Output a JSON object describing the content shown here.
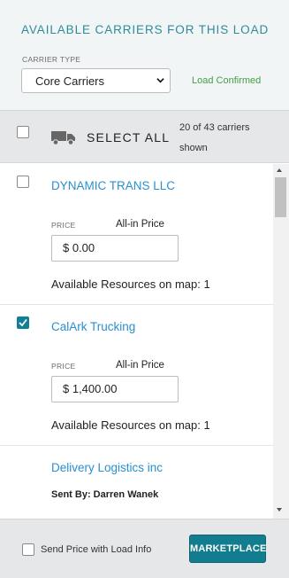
{
  "header": {
    "title": "AVAILABLE CARRIERS FOR THIS LOAD",
    "carrier_type_label": "CARRIER TYPE",
    "carrier_type_selected": "Core Carriers",
    "status": "Load Confirmed"
  },
  "select_bar": {
    "select_all_label": "SELECT ALL",
    "shown_text": "20 of 43 carriers shown",
    "select_all_checked": false
  },
  "carriers": [
    {
      "name": "DYNAMIC TRANS LLC",
      "checked": false,
      "price_label": "PRICE",
      "price_type": "All-in Price",
      "price_value": "$ 0.00",
      "resources_text": "Available Resources on map:  1"
    },
    {
      "name": "CalArk Trucking",
      "checked": true,
      "price_label": "PRICE",
      "price_type": "All-in Price",
      "price_value": "$ 1,400.00",
      "resources_text": "Available Resources on map:  1"
    },
    {
      "name": "Delivery Logistics inc",
      "sent_by": "Sent By: Darren Wanek"
    }
  ],
  "footer": {
    "send_price_label": "Send Price with Load Info",
    "send_price_checked": false,
    "marketplace_label": "MARKETPLACE"
  },
  "colors": {
    "accent": "#127d8e",
    "link": "#2a8fcf",
    "status_green": "#43a047",
    "header_bg": "#f2f5f6",
    "bar_bg": "#e5e7e9"
  },
  "icons": {
    "truck": "truck-icon",
    "select_arrow": "chevron-down-icon",
    "check": "check-icon"
  }
}
